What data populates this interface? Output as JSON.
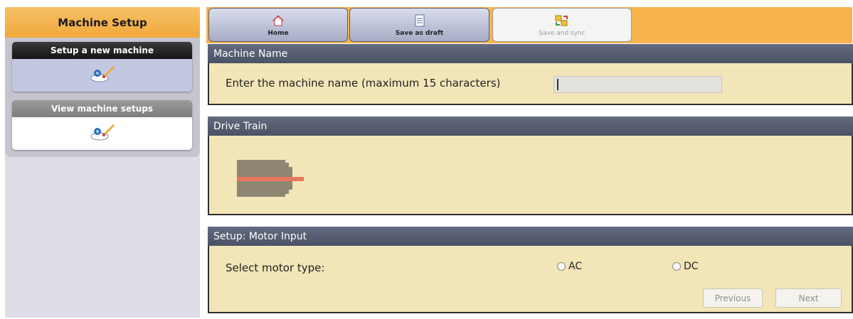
{
  "sidebar": {
    "title": "Machine Setup",
    "items": [
      {
        "label": "Setup a new machine",
        "icon": "machine-setup-icon"
      },
      {
        "label": "View machine setups",
        "icon": "machine-setup-icon"
      }
    ]
  },
  "toolbar": {
    "home_label": "Home",
    "save_draft_label": "Save as draft",
    "save_sync_label": "Save and sync"
  },
  "sections": {
    "machine_name": {
      "title": "Machine Name",
      "prompt": "Enter the machine name (maximum 15 characters)",
      "value": ""
    },
    "drive_train": {
      "title": "Drive Train",
      "icon": "motor-shaft-icon"
    },
    "motor_input": {
      "title": "Setup: Motor Input",
      "prompt": "Select motor type:",
      "options": [
        "AC",
        "DC"
      ],
      "selected": null
    }
  },
  "navigation": {
    "previous_label": "Previous",
    "next_label": "Next"
  },
  "colors": {
    "accent_orange": "#f7b44d",
    "section_bg": "#f2e6b8",
    "section_header": "#575e73",
    "drive_motor_body": "#8e8672",
    "drive_shaft": "#e8765a"
  }
}
